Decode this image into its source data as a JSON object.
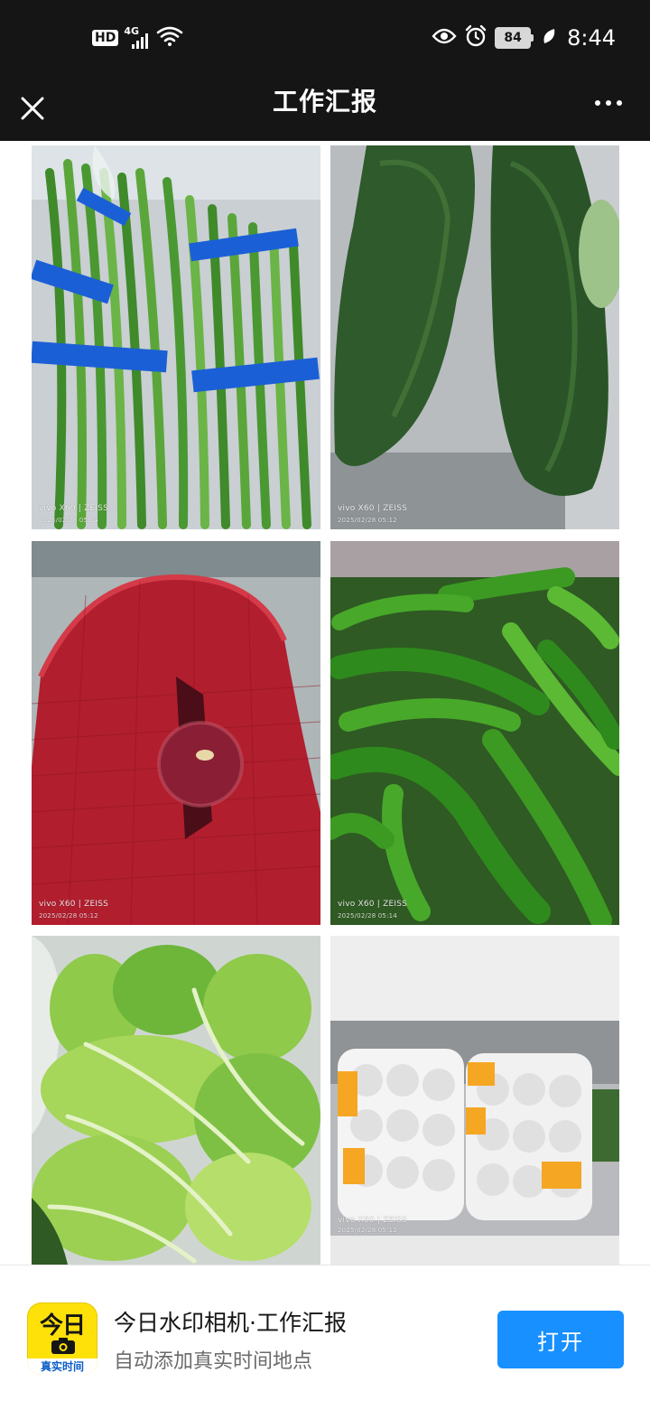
{
  "status_bar": {
    "hd": "HD",
    "network": "4G",
    "battery": "84",
    "time": "8:44"
  },
  "header": {
    "title": "工作汇报"
  },
  "photos": [
    {
      "name": "long-beans-photo",
      "watermark_device": "vivo X60 | ZEISS",
      "watermark_date": "2025/02/28 05:14"
    },
    {
      "name": "winter-melon-photo",
      "watermark_device": "vivo X60 | ZEISS",
      "watermark_date": "2025/02/28 05:12"
    },
    {
      "name": "red-onion-sack-photo",
      "watermark_device": "vivo X60 | ZEISS",
      "watermark_date": "2025/02/28 05:12"
    },
    {
      "name": "green-peppers-photo",
      "watermark_device": "vivo X60 | ZEISS",
      "watermark_date": "2025/02/28 05:14"
    },
    {
      "name": "mustard-greens-photo",
      "watermark_device": "",
      "watermark_date": ""
    },
    {
      "name": "bagged-vegetables-photo",
      "watermark_device": "vivo X60 | ZEISS",
      "watermark_date": "2025/02/28 05:12"
    }
  ],
  "banner": {
    "app_icon_text": "今日",
    "app_icon_strip": "真实时间",
    "title": "今日水印相机·工作汇报",
    "subtitle": "自动添加真实时间地点",
    "open_button": "打开"
  },
  "colors": {
    "status_bg": "#151515",
    "button_blue": "#1890ff",
    "icon_yellow": "#ffe10a"
  }
}
